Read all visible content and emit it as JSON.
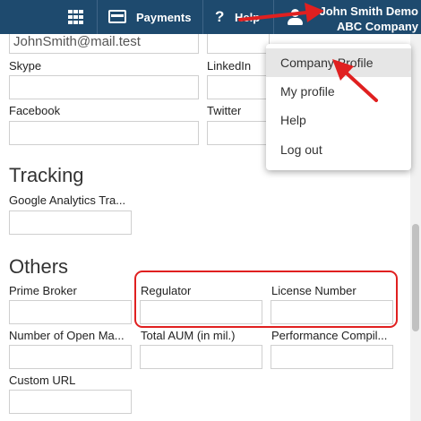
{
  "topbar": {
    "payments_label": "Payments",
    "help_label": "Help",
    "user_name": "John Smith Demo",
    "company_name": "ABC Company"
  },
  "form": {
    "email_value": "JohnSmith@mail.test",
    "skype_label": "Skype",
    "linkedin_label": "LinkedIn",
    "facebook_label": "Facebook",
    "twitter_label": "Twitter",
    "tracking_heading": "Tracking",
    "google_analytics_label": "Google Analytics Tra...",
    "others_heading": "Others",
    "prime_broker_label": "Prime Broker",
    "regulator_label": "Regulator",
    "license_number_label": "License Number",
    "open_ma_label": "Number of Open Ma...",
    "total_aum_label": "Total AUM (in mil.)",
    "performance_label": "Performance Compil...",
    "custom_url_label": "Custom URL"
  },
  "menu": {
    "items": [
      "Company Profile",
      "My profile",
      "Help",
      "Log out"
    ],
    "highlighted_index": 0
  },
  "colors": {
    "topbar_bg": "#1e4a6e",
    "annotation": "#e02020"
  }
}
